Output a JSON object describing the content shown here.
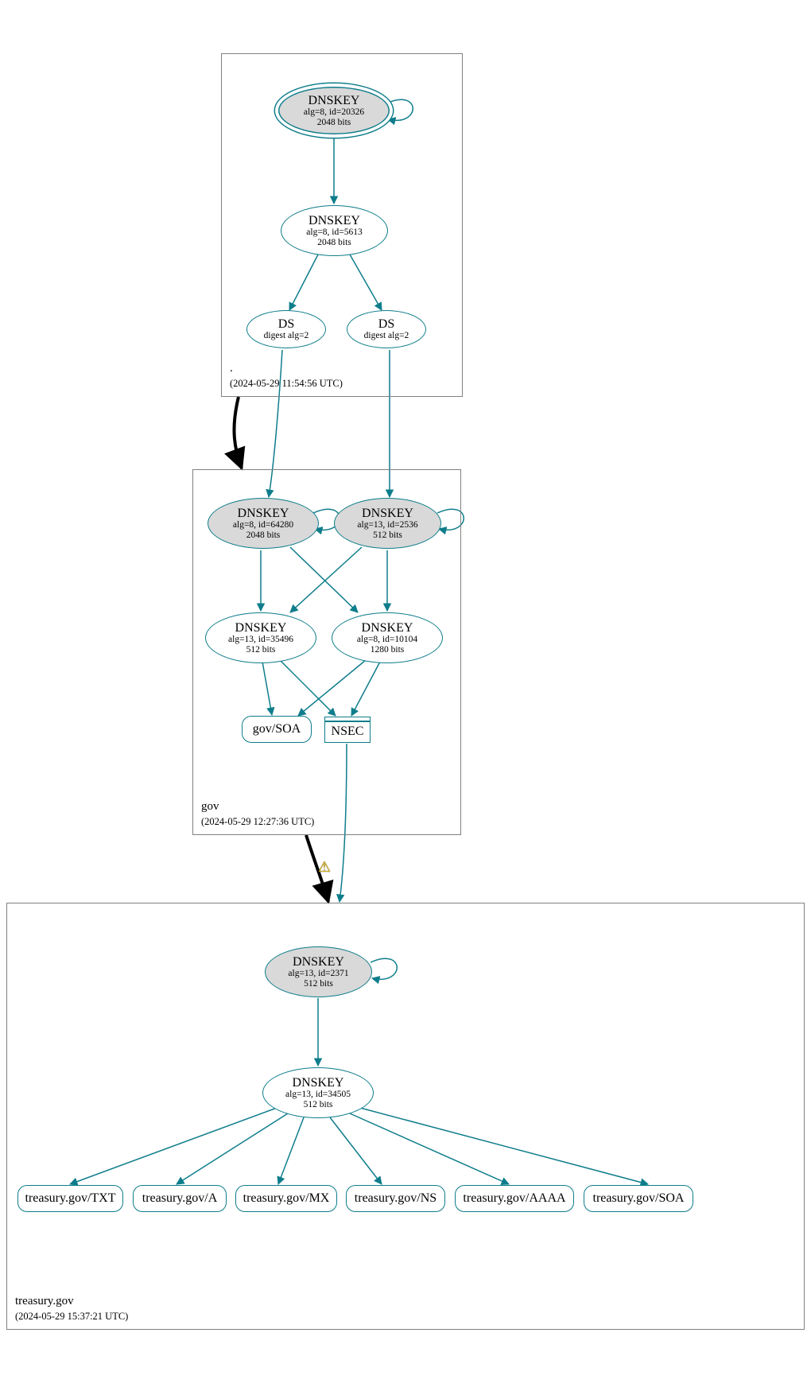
{
  "zones": {
    "root": {
      "name": ".",
      "timestamp": "(2024-05-29 11:54:56 UTC)"
    },
    "gov": {
      "name": "gov",
      "timestamp": "(2024-05-29 12:27:36 UTC)"
    },
    "treasury": {
      "name": "treasury.gov",
      "timestamp": "(2024-05-29 15:37:21 UTC)"
    }
  },
  "nodes": {
    "root_ksk": {
      "title": "DNSKEY",
      "sub1": "alg=8, id=20326",
      "sub2": "2048 bits"
    },
    "root_zsk": {
      "title": "DNSKEY",
      "sub1": "alg=8, id=5613",
      "sub2": "2048 bits"
    },
    "ds1": {
      "title": "DS",
      "sub1": "digest alg=2"
    },
    "ds2": {
      "title": "DS",
      "sub1": "digest alg=2"
    },
    "gov_ksk1": {
      "title": "DNSKEY",
      "sub1": "alg=8, id=64280",
      "sub2": "2048 bits"
    },
    "gov_ksk2": {
      "title": "DNSKEY",
      "sub1": "alg=13, id=2536",
      "sub2": "512 bits"
    },
    "gov_zsk1": {
      "title": "DNSKEY",
      "sub1": "alg=13, id=35496",
      "sub2": "512 bits"
    },
    "gov_zsk2": {
      "title": "DNSKEY",
      "sub1": "alg=8, id=10104",
      "sub2": "1280 bits"
    },
    "gov_soa": {
      "title": "gov/SOA"
    },
    "nsec": {
      "title": "NSEC"
    },
    "treasury_ksk": {
      "title": "DNSKEY",
      "sub1": "alg=13, id=2371",
      "sub2": "512 bits"
    },
    "treasury_zsk": {
      "title": "DNSKEY",
      "sub1": "alg=13, id=34505",
      "sub2": "512 bits"
    },
    "rr_txt": {
      "title": "treasury.gov/TXT"
    },
    "rr_a": {
      "title": "treasury.gov/A"
    },
    "rr_mx": {
      "title": "treasury.gov/MX"
    },
    "rr_ns": {
      "title": "treasury.gov/NS"
    },
    "rr_aaaa": {
      "title": "treasury.gov/AAAA"
    },
    "rr_soa": {
      "title": "treasury.gov/SOA"
    }
  },
  "warning_glyph": "⚠"
}
